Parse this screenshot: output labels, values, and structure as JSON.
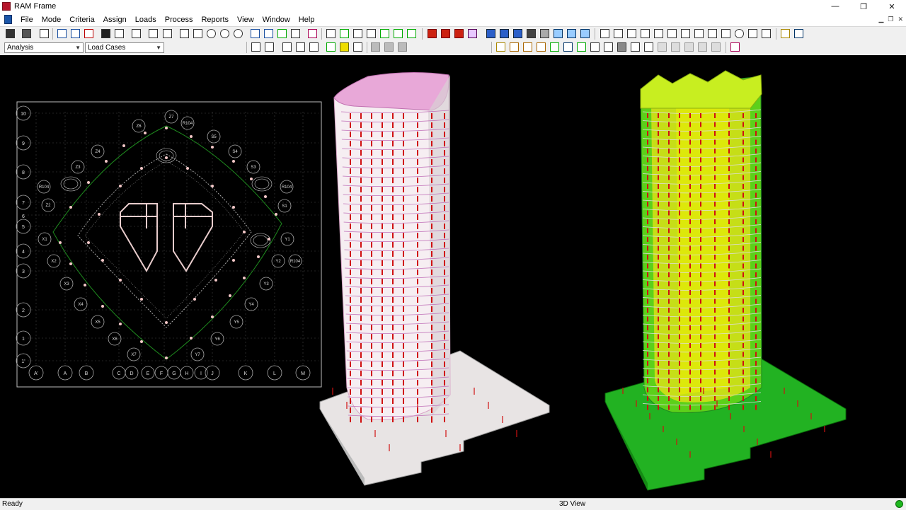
{
  "window": {
    "title": "RAM Frame",
    "min": "—",
    "restore": "❐",
    "close": "✕"
  },
  "menu": [
    "File",
    "Mode",
    "Criteria",
    "Assign",
    "Loads",
    "Process",
    "Reports",
    "View",
    "Window",
    "Help"
  ],
  "toolbar2": {
    "mode_select": "Analysis",
    "load_select": "Load Cases"
  },
  "plan": {
    "top_labels": [
      "Z6",
      "Z7",
      "R104",
      "S6",
      "S5",
      "Z4",
      "S4",
      "Z3",
      "S3"
    ],
    "left_grid": [
      "10",
      "9",
      "8",
      "7",
      "6",
      "5",
      "4",
      "3",
      "2",
      "1",
      "1'"
    ],
    "bottom_grid": [
      "A'",
      "A",
      "B",
      "C",
      "D",
      "E",
      "F",
      "G",
      "H",
      "I",
      "J",
      "K",
      "L",
      "M"
    ],
    "side_labels": [
      "R104",
      "Z2",
      "X1",
      "X2",
      "X3",
      "X4",
      "X5",
      "X6",
      "X7",
      "Y1",
      "Y2",
      "Y3",
      "Y4",
      "Y5",
      "Y6",
      "Y7",
      "R104",
      "S1",
      "S2",
      "R104"
    ]
  },
  "status": {
    "left": "Ready",
    "mid": "3D View"
  },
  "colors": {
    "frame_red": "#d01010",
    "slab_green": "#1fb01f",
    "core_yellow": "#e8e010",
    "plan_line": "#e0d8d8",
    "background": "#000000"
  }
}
